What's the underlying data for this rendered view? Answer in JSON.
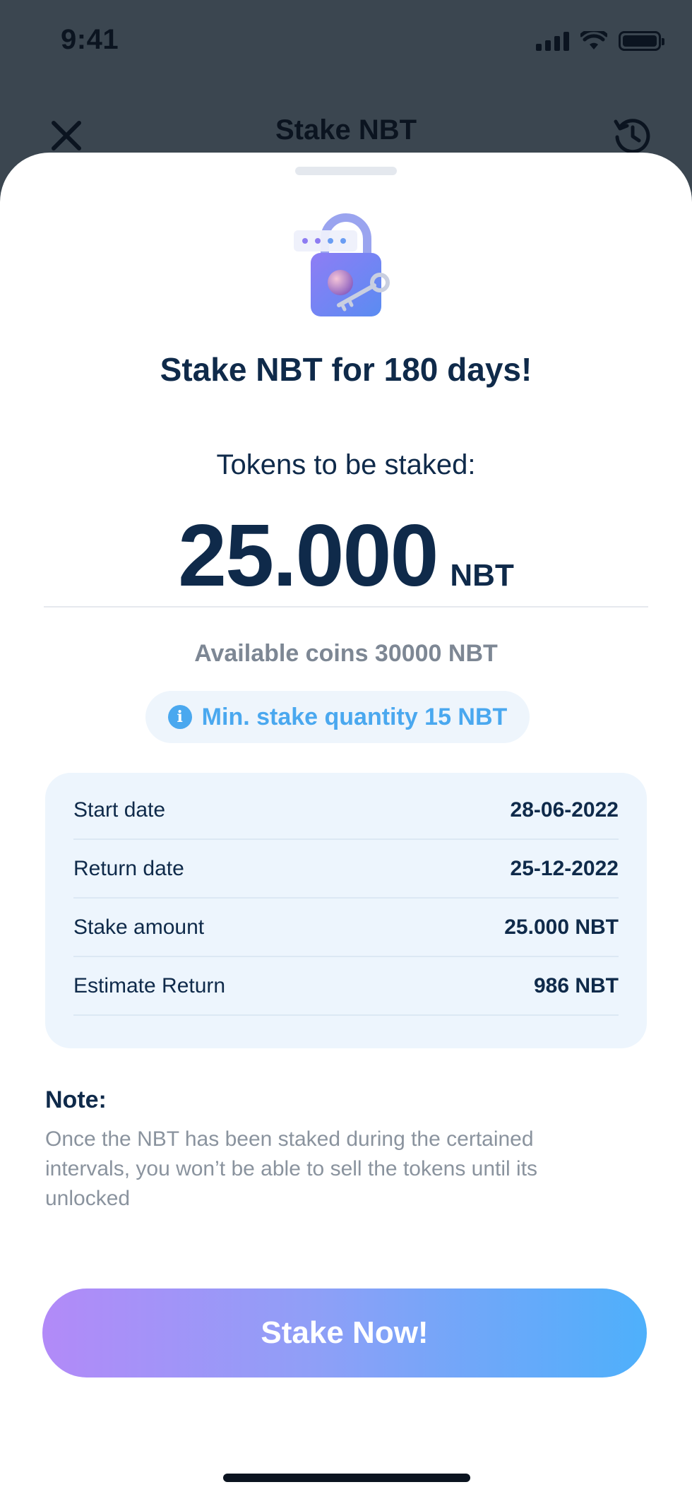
{
  "status_bar": {
    "time": "9:41"
  },
  "nav": {
    "title": "Stake NBT"
  },
  "sheet": {
    "headline": "Stake NBT for 180 days!",
    "tokens_label": "Tokens to be staked:",
    "amount": "25.000",
    "amount_unit": "NBT",
    "available": "Available coins 30000 NBT",
    "min_stake": "Min. stake quantity 15 NBT",
    "details": [
      {
        "label": "Start date",
        "value": "28-06-2022"
      },
      {
        "label": "Return date",
        "value": "25-12-2022"
      },
      {
        "label": "Stake amount",
        "value": "25.000 NBT"
      },
      {
        "label": "Estimate Return",
        "value": "986 NBT"
      }
    ],
    "note_title": "Note:",
    "note_body": "Once the NBT has been staked during the certained intervals, you won’t be able to sell the tokens until its unlocked",
    "button_label": "Stake Now!"
  },
  "icons": {
    "close": "close-icon",
    "history": "history-icon",
    "info": "info-icon",
    "illustration": "lock-key-icon"
  },
  "colors": {
    "overlay": "#3b4650",
    "primary_text": "#0f2a4a",
    "accent_blue": "#4aa8ef",
    "card_bg": "#edf5fd",
    "button_gradient_start": "#b28af8",
    "button_gradient_end": "#4eb0fb"
  }
}
